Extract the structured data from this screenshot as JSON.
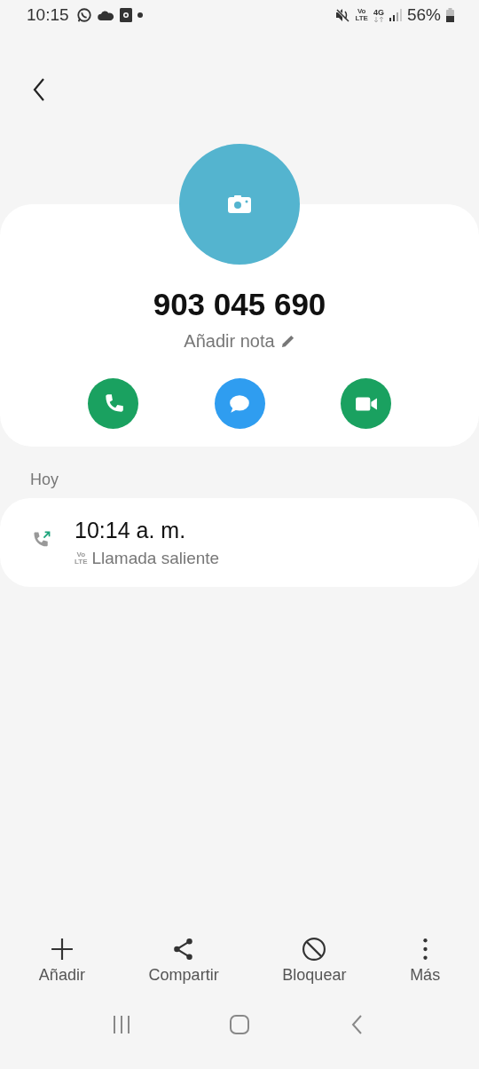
{
  "status_bar": {
    "time": "10:15",
    "network": "4G",
    "lte_top": "Vo",
    "lte_bottom": "LTE",
    "battery": "56%"
  },
  "contact": {
    "number": "903 045 690",
    "note_placeholder": "Añadir nota"
  },
  "actions": [
    {
      "kind": "call"
    },
    {
      "kind": "message"
    },
    {
      "kind": "video"
    }
  ],
  "history": {
    "section": "Hoy",
    "entries": [
      {
        "time": "10:14 a. m.",
        "lte_top": "Vo",
        "lte_bottom": "LTE",
        "type": "Llamada saliente",
        "kind": "outgoing"
      }
    ]
  },
  "bottom_actions": [
    {
      "kind": "add",
      "label": "Añadir"
    },
    {
      "kind": "share",
      "label": "Compartir"
    },
    {
      "kind": "block",
      "label": "Bloquear"
    },
    {
      "kind": "more",
      "label": "Más"
    }
  ],
  "nav_bar": [
    {
      "kind": "recents"
    },
    {
      "kind": "home"
    },
    {
      "kind": "back"
    }
  ]
}
